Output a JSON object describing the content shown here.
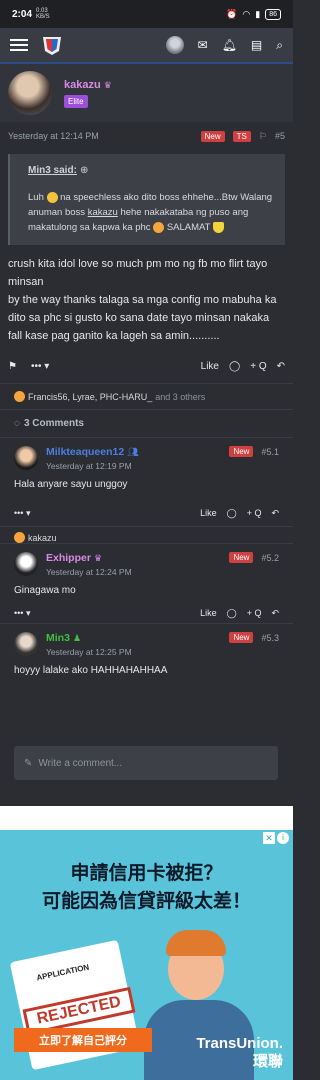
{
  "status": {
    "time": "2:04",
    "speed_top": "0.03",
    "speed_bottom": "KB/S",
    "battery": "86"
  },
  "post": {
    "author": "kakazu",
    "badge": "Elite",
    "time": "Yesterday at 12:14 PM",
    "tag_new": "New",
    "tag_ts": "TS",
    "post_number": "#5",
    "quote": {
      "header": "Min3 said:",
      "text_before": "Luh",
      "text_mid": "na speechless ako dito boss ehhehe...Btw Walang anuman boss",
      "mention": "kakazu",
      "text_after": "hehe nakakataba ng puso ang makatulong sa kapwa ka phc",
      "text_end": "SALAMAT"
    },
    "body_lines": [
      "crush kita idol love so much pm mo ng fb mo flirt tayo minsan",
      "by the way thanks talaga sa mga config mo mabuha ka dito sa phc si gusto ko sana date tayo minsan nakaka fall kase pag ganito ka lageh sa amin.........."
    ],
    "more_label": "•••",
    "like_label": "Like",
    "quote_label": "+ Q",
    "reactions": {
      "names": "Francis56, Lyrae, PHC-HARU_",
      "others": "and 3 others"
    },
    "comments_count": "3 Comments"
  },
  "comments": [
    {
      "name": "Milkteaqueen12",
      "name_color": "#4a7fe0",
      "time": "Yesterday at 12:19 PM",
      "tag": "New",
      "num": "#5.1",
      "text": "Hala anyare sayu unggoy",
      "reaction": "kakazu"
    },
    {
      "name": "Exhipper",
      "name_color": "#d88be6",
      "time": "Yesterday at 12:24 PM",
      "tag": "New",
      "num": "#5.2",
      "text": "Ginagawa mo",
      "reaction": ""
    },
    {
      "name": "Min3",
      "name_color": "#3fbf3f",
      "time": "Yesterday at 12:25 PM",
      "tag": "New",
      "num": "#5.3",
      "text": "hoyyy lalake ako HAHHAHAHHAA",
      "reaction": ""
    }
  ],
  "comment_like": "Like",
  "comment_quote": "+ Q",
  "comment_more": "•••",
  "write_placeholder": "Write a comment...",
  "ad": {
    "headline_1": "申請信用卡被拒？",
    "headline_2": "可能因為信貸評級太差！",
    "application": "APPLICATION",
    "rejected": "REJECTED",
    "cta": "立即了解自己評分",
    "brand": "TransUnion.",
    "brand_zh": "環聯"
  },
  "colors": {
    "accent": "#2a4d8a",
    "new_tag": "#d04040",
    "elite": "#9c4fd9"
  }
}
